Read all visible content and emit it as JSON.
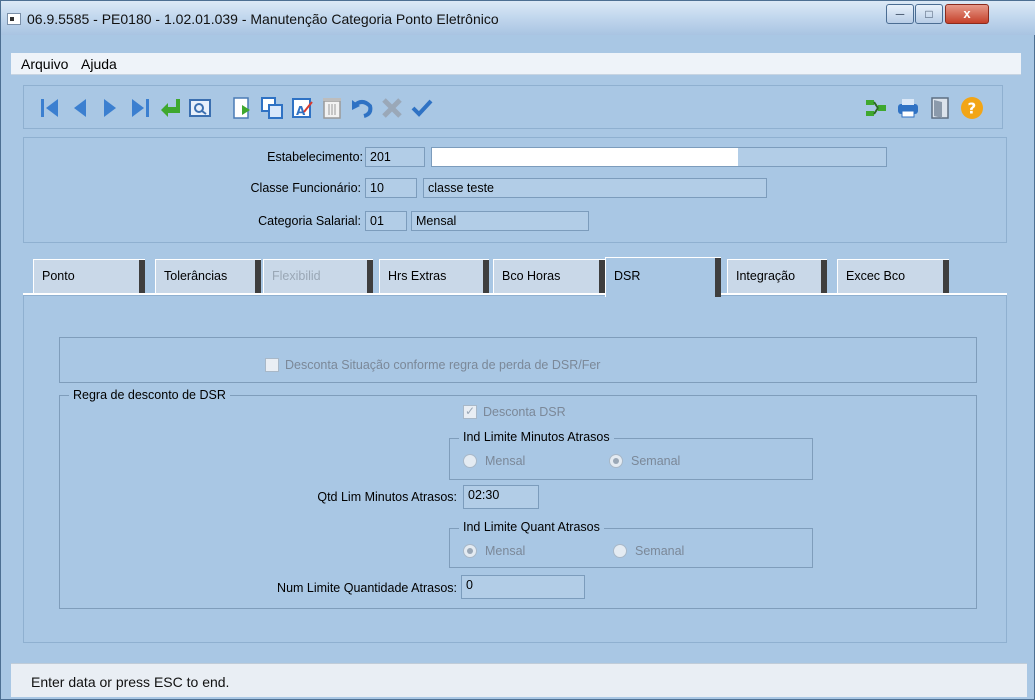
{
  "window": {
    "title": "06.9.5585 - PE0180 - 1.02.01.039 - Manutenção Categoria Ponto Eletrônico",
    "close_glyph": "x"
  },
  "menu": {
    "items": [
      "Arquivo",
      "Ajuda"
    ]
  },
  "toolbar": {
    "icons": [
      "first-record-icon",
      "previous-record-icon",
      "next-record-icon",
      "last-record-icon",
      "goto-icon",
      "search-icon",
      "new-record-icon",
      "copy-record-icon",
      "edit-record-icon",
      "delete-record-icon",
      "undo-icon",
      "cancel-icon",
      "save-icon",
      "zoom-icon",
      "print-icon",
      "exit-icon",
      "help-icon"
    ]
  },
  "header": {
    "estabelecimento": {
      "label": "Estabelecimento:",
      "code": "201",
      "name": ""
    },
    "classe": {
      "label": "Classe Funcionário:",
      "code": "10",
      "name": "classe teste"
    },
    "categoria": {
      "label": "Categoria Salarial:",
      "code": "01",
      "name": "Mensal"
    }
  },
  "tabs": [
    {
      "label": "Ponto",
      "state": "normal"
    },
    {
      "label": "Tolerâncias",
      "state": "normal"
    },
    {
      "label": "Flexibilid",
      "state": "disabled"
    },
    {
      "label": "Hrs Extras",
      "state": "normal"
    },
    {
      "label": "Bco Horas",
      "state": "normal"
    },
    {
      "label": "DSR",
      "state": "active"
    },
    {
      "label": "Integração",
      "state": "normal"
    },
    {
      "label": "Excec Bco",
      "state": "normal"
    }
  ],
  "dsr": {
    "desconta_situacao": "Desconta Situação conforme regra de perda de DSR/Fer",
    "regra_title": "Regra de desconto de DSR",
    "desconta_dsr": "Desconta DSR",
    "ind_min_title": "Ind Limite Minutos Atrasos",
    "ind_min_opt1": "Mensal",
    "ind_min_opt2": "Semanal",
    "qtd_lim_label": "Qtd Lim Minutos Atrasos:",
    "qtd_lim_value": "02:30",
    "ind_quant_title": "Ind Limite Quant Atrasos",
    "ind_quant_opt1": "Mensal",
    "ind_quant_opt2": "Semanal",
    "num_lim_label": "Num Limite Quantidade Atrasos:",
    "num_lim_value": "0"
  },
  "status": {
    "text": "Enter data or press ESC to end."
  }
}
